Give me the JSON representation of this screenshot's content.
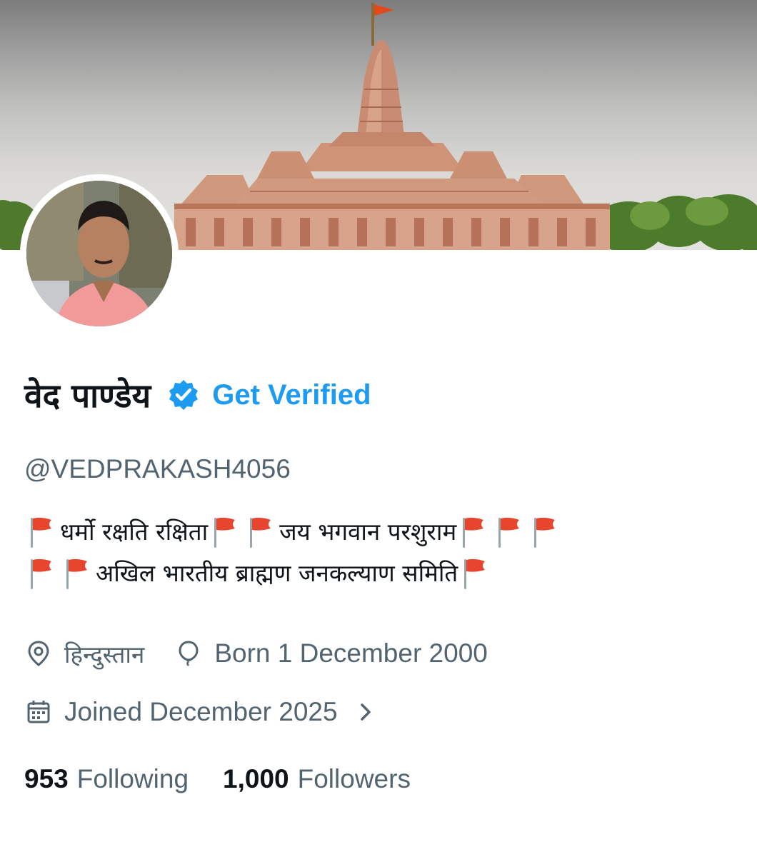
{
  "profile": {
    "display_name": "वेद पाण्डेय",
    "get_verified_label": "Get Verified",
    "handle": "@VEDPRAKASH4056",
    "bio": {
      "line1": [
        {
          "type": "flag"
        },
        {
          "type": "text",
          "value": "धर्मो रक्षति रक्षिता"
        },
        {
          "type": "flag"
        },
        {
          "type": "flag"
        },
        {
          "type": "text",
          "value": "जय भगवान परशुराम"
        },
        {
          "type": "flag"
        },
        {
          "type": "flag"
        },
        {
          "type": "flag"
        }
      ],
      "line2": [
        {
          "type": "flag"
        },
        {
          "type": "flag"
        },
        {
          "type": "text",
          "value": "अखिल भारतीय ब्राह्मण जनकल्याण समिति"
        },
        {
          "type": "flag"
        }
      ],
      "segments": {
        "s1": "धर्मो रक्षति रक्षिता",
        "s2": "जय भगवान परशुराम",
        "s3": "अखिल भारतीय ब्राह्मण जनकल्याण समिति"
      }
    },
    "location": "हिन्दुस्तान",
    "birthday": "Born 1 December 2000",
    "joined": "Joined December 2025",
    "following_count": "953",
    "following_label": "Following",
    "followers_count": "1,000",
    "followers_label": "Followers"
  },
  "icons": {
    "verified": "verified-badge-icon",
    "location": "location-pin-icon",
    "birthday": "balloon-icon",
    "joined": "calendar-icon",
    "expand": "chevron-right-icon",
    "flag": "red-triangular-flag-icon"
  },
  "colors": {
    "accent": "#1d9bf0",
    "text_primary": "#0f1419",
    "text_secondary": "#536471",
    "flag_red": "#e8452f"
  }
}
